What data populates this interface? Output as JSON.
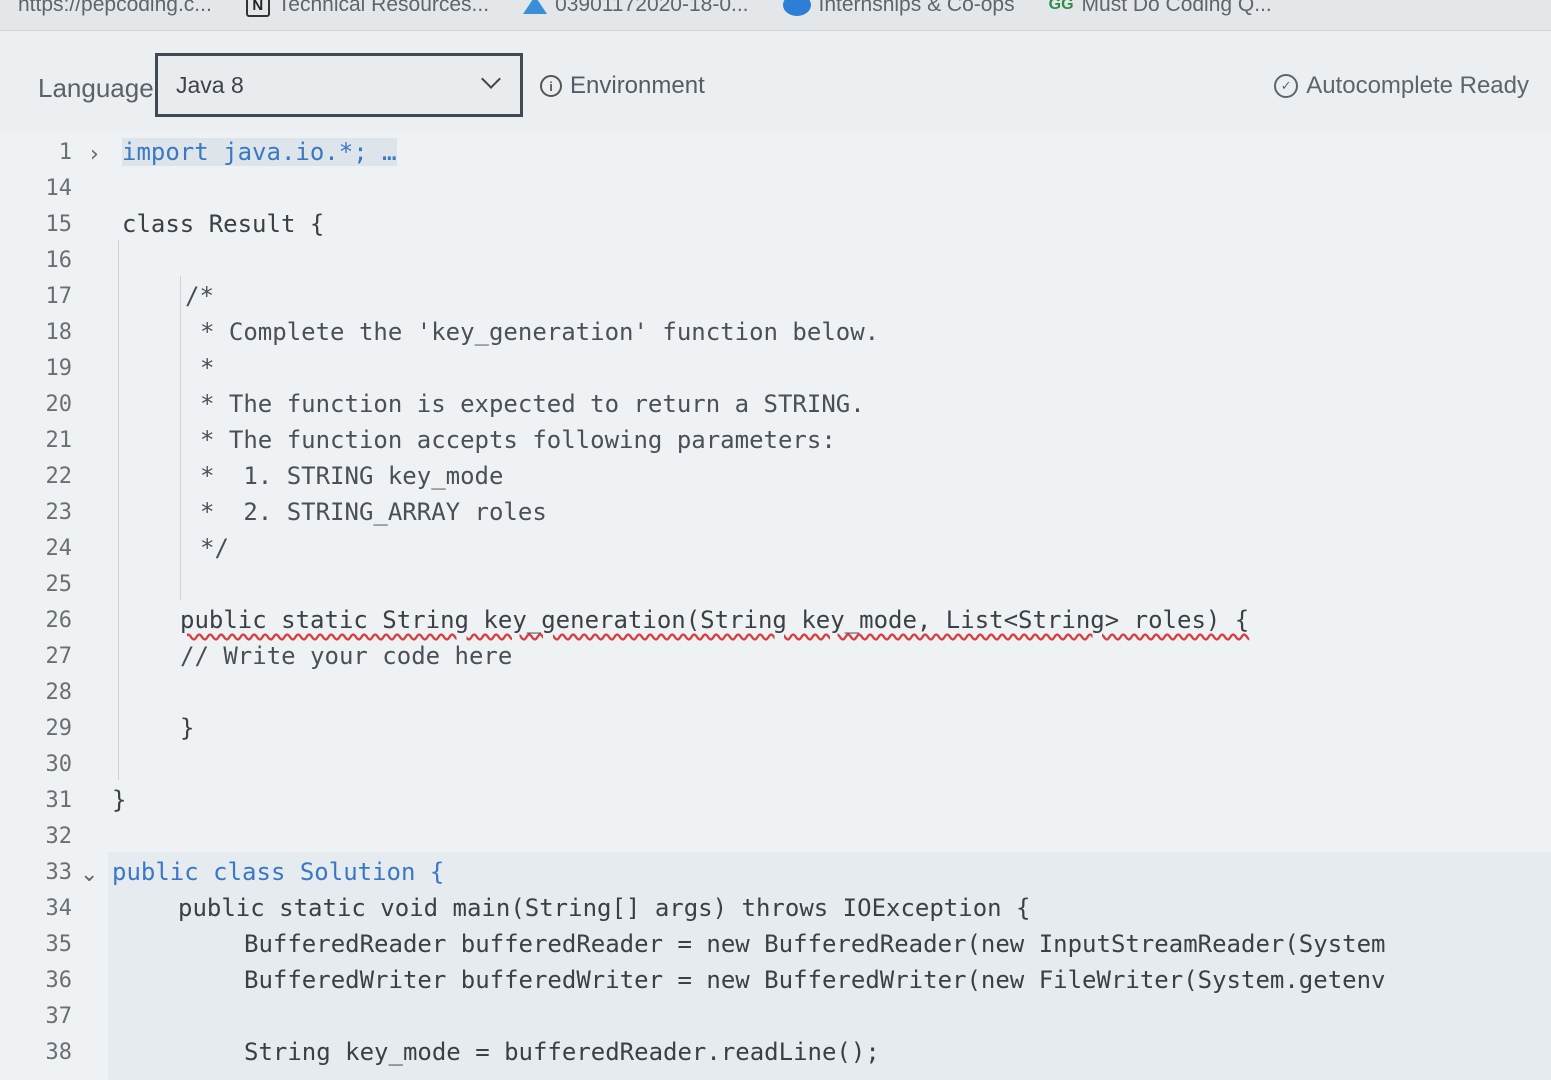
{
  "bookmarks": [
    {
      "label": "https://pepcoding.c...",
      "icon": "none"
    },
    {
      "label": "Technical Resources...",
      "icon": "notion-icon"
    },
    {
      "label": "03901172020-18-0...",
      "icon": "drive-icon"
    },
    {
      "label": "Internships & Co-ops",
      "icon": "globe-icon"
    },
    {
      "label": "Must Do Coding Q...",
      "icon": "gfg-icon"
    }
  ],
  "toolbar": {
    "language_label": "Language",
    "language_value": "Java 8",
    "environment_label": "Environment",
    "autocomplete_label": "Autocomplete Ready"
  },
  "editor": {
    "lines": [
      {
        "n": "1",
        "text": "import java.io.*; …"
      },
      {
        "n": "14",
        "text": ""
      },
      {
        "n": "15",
        "text": "class Result {"
      },
      {
        "n": "16",
        "text": ""
      },
      {
        "n": "17",
        "text": "/*"
      },
      {
        "n": "18",
        "text": "* Complete the 'key_generation' function below."
      },
      {
        "n": "19",
        "text": "*"
      },
      {
        "n": "20",
        "text": "* The function is expected to return a STRING."
      },
      {
        "n": "21",
        "text": "* The function accepts following parameters:"
      },
      {
        "n": "22",
        "text": "*  1. STRING key_mode"
      },
      {
        "n": "23",
        "text": "*  2. STRING_ARRAY roles"
      },
      {
        "n": "24",
        "text": "*/"
      },
      {
        "n": "25",
        "text": ""
      },
      {
        "n": "26",
        "text": "public static String key_generation(String key_mode, List<String> roles) {"
      },
      {
        "n": "27",
        "text": "// Write your code here"
      },
      {
        "n": "28",
        "text": ""
      },
      {
        "n": "29",
        "text": "}"
      },
      {
        "n": "30",
        "text": ""
      },
      {
        "n": "31",
        "text": "}"
      },
      {
        "n": "32",
        "text": ""
      },
      {
        "n": "33",
        "text": "public class Solution {"
      },
      {
        "n": "34",
        "text": "public static void main(String[] args) throws IOException {"
      },
      {
        "n": "35",
        "text": "BufferedReader bufferedReader = new BufferedReader(new InputStreamReader(System"
      },
      {
        "n": "36",
        "text": "BufferedWriter bufferedWriter = new BufferedWriter(new FileWriter(System.getenv"
      },
      {
        "n": "37",
        "text": ""
      },
      {
        "n": "38",
        "text": "String key_mode = bufferedReader.readLine();"
      }
    ]
  }
}
